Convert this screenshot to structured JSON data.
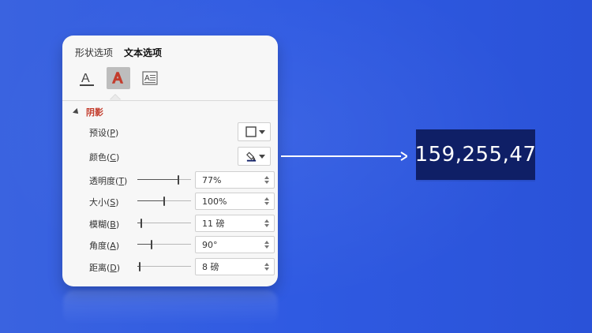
{
  "panel": {
    "tabs": [
      {
        "label": "形状选项",
        "active": false
      },
      {
        "label": "文本选项",
        "active": true
      }
    ],
    "icon_names": [
      "text-fill-outline-icon",
      "text-effects-icon",
      "textbox-icon"
    ],
    "section_title": "阴影",
    "rows": {
      "preset": {
        "label_main": "预设(",
        "label_key": "P",
        "label_end": ")"
      },
      "color": {
        "label_main": "颜色(",
        "label_key": "C",
        "label_end": ")"
      },
      "transparency": {
        "label_main": "透明度(",
        "label_key": "T",
        "label_end": ")",
        "value": "77%",
        "level": 0.77
      },
      "size": {
        "label_main": "大小(",
        "label_key": "S",
        "label_end": ")",
        "value": "100%",
        "level": 0.5
      },
      "blur": {
        "label_main": "模糊(",
        "label_key": "B",
        "label_end": ")",
        "value": "11 磅",
        "level": 0.06
      },
      "angle": {
        "label_main": "角度(",
        "label_key": "A",
        "label_end": ")",
        "value": "90°",
        "level": 0.25
      },
      "distance": {
        "label_main": "距离(",
        "label_key": "D",
        "label_end": ")",
        "value": "8 磅",
        "level": 0.03
      }
    }
  },
  "result_value": "159,255,47",
  "colors": {
    "background": "#2f5ae2",
    "accent_red": "#c33b2b",
    "result_box": "#0f1f66"
  }
}
